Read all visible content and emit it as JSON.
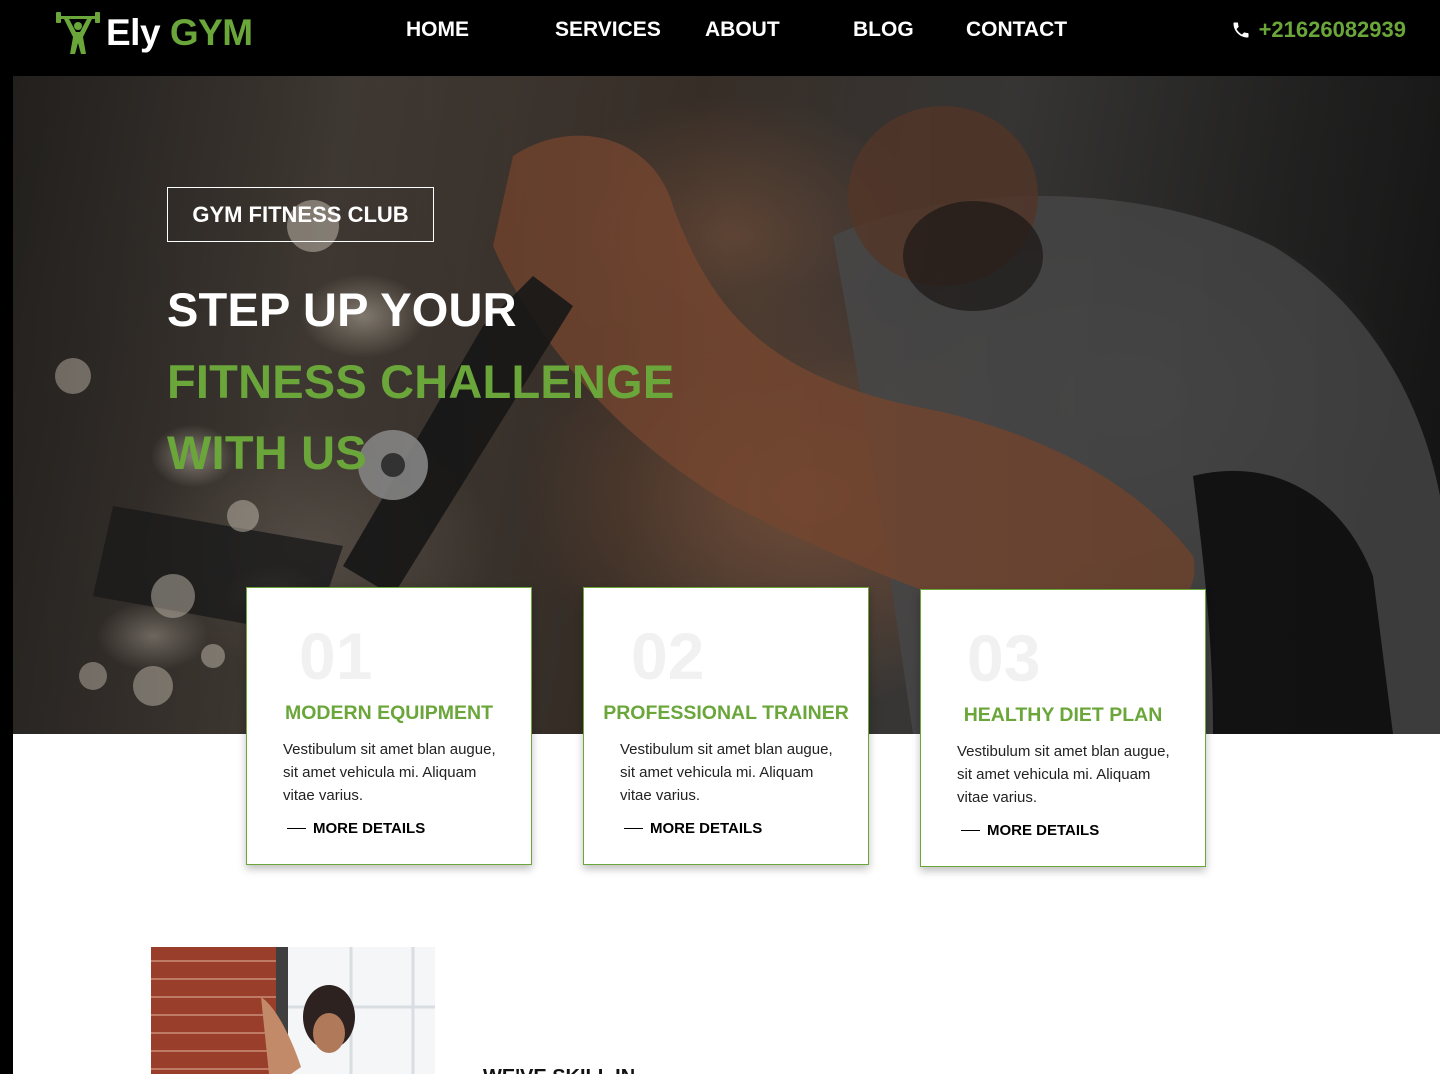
{
  "brand": {
    "name_first": "Ely",
    "name_second": "GYM"
  },
  "nav": {
    "items": [
      {
        "label": "HOME"
      },
      {
        "label": "SERVICES"
      },
      {
        "label": "ABOUT"
      },
      {
        "label": "BLOG"
      },
      {
        "label": "CONTACT"
      }
    ],
    "phone": "+21626082939"
  },
  "hero": {
    "badge": "GYM FITNESS CLUB",
    "headline_line1": "STEP UP YOUR",
    "headline_line2": "FITNESS CHALLENGE",
    "headline_line3": "WITH US"
  },
  "cards": [
    {
      "number": "01",
      "title": "MODERN EQUIPMENT",
      "body": "Vestibulum sit amet blan augue, sit amet vehicula mi. Aliquam vitae varius.",
      "link": "MORE DETAILS"
    },
    {
      "number": "02",
      "title": "PROFESSIONAL TRAINER",
      "body": "Vestibulum sit amet blan augue, sit amet vehicula mi. Aliquam vitae varius.",
      "link": "MORE DETAILS"
    },
    {
      "number": "03",
      "title": "HEALTHY DIET PLAN",
      "body": "Vestibulum sit amet blan augue, sit amet vehicula mi. Aliquam vitae varius.",
      "link": "MORE DETAILS"
    }
  ],
  "about": {
    "heading_partial": "WE'VE SKILL IN"
  },
  "colors": {
    "accent": "#6aa63a",
    "nav_bg": "#000000",
    "text_dark": "#222222"
  },
  "icons": {
    "logo": "dumbbell-man-icon",
    "phone": "phone-icon",
    "link_marker": "dash-icon"
  }
}
